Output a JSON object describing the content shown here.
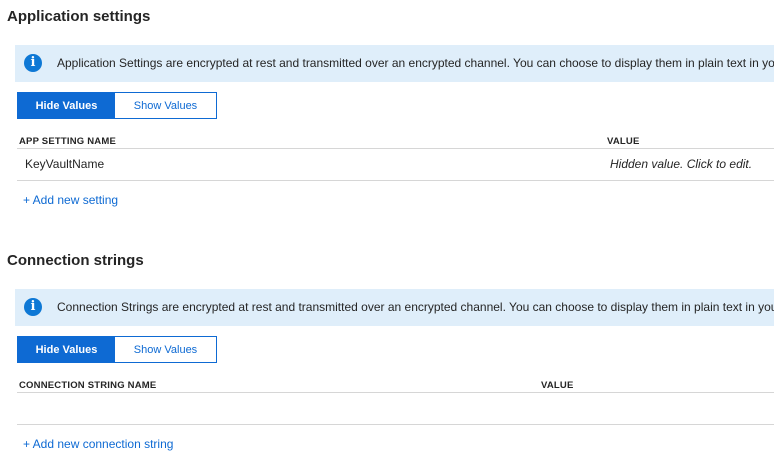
{
  "app_settings": {
    "title": "Application settings",
    "info_icon": "info-icon",
    "info_text": "Application Settings are encrypted at rest and transmitted over an encrypted channel. You can choose to display them in plain text in your browser by using the controls below.",
    "toggle": {
      "hide_label": "Hide Values",
      "show_label": "Show Values",
      "selected": "Hide Values"
    },
    "table": {
      "columns": [
        "APP SETTING NAME",
        "VALUE"
      ],
      "rows": [
        {
          "name": "KeyVaultName",
          "value": "Hidden value. Click to edit."
        }
      ]
    },
    "add_link": "+ Add new setting"
  },
  "connection_strings": {
    "title": "Connection strings",
    "info_icon": "info-icon",
    "info_text": "Connection Strings are encrypted at rest and transmitted over an encrypted channel. You can choose to display them in plain text in your browser by using the controls below.",
    "toggle": {
      "hide_label": "Hide Values",
      "show_label": "Show Values",
      "selected": "Hide Values"
    },
    "table": {
      "columns": [
        "CONNECTION STRING NAME",
        "VALUE"
      ],
      "rows": []
    },
    "add_link": "+ Add new connection string"
  },
  "colors": {
    "accent": "#0e6ad3",
    "info_background": "#dfeefa",
    "info_icon": "#0e78d5",
    "divider": "#d6d6d6"
  }
}
